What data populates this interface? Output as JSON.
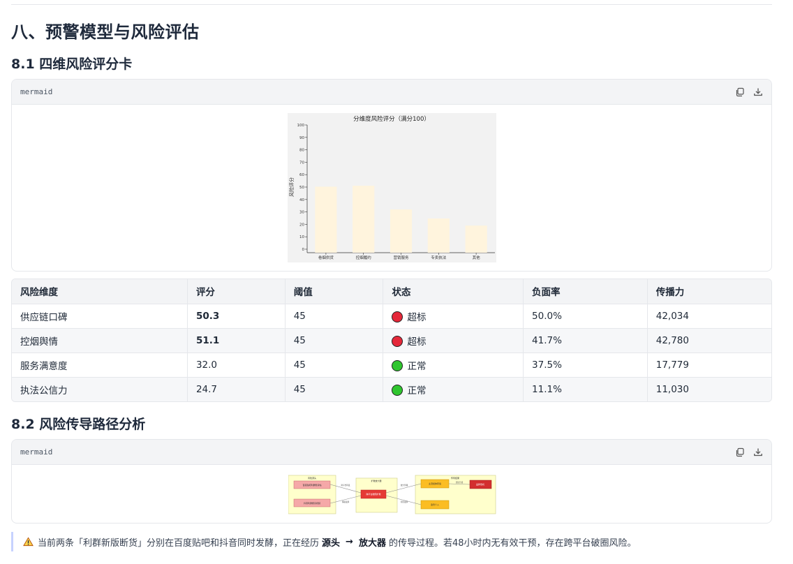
{
  "section_title": "八、预警模型与风险评估",
  "sub1_title": "8.1 四维风险评分卡",
  "sub2_title": "8.2 风险传导路径分析",
  "code_lang": "mermaid",
  "chart_data": {
    "type": "bar",
    "title": "分维度风险评分（满分100）",
    "ylabel": "风险评分",
    "xlabel": "",
    "categories": [
      "卷烟供货",
      "控烟履约",
      "营销服务",
      "专卖执法",
      "其他"
    ],
    "values": [
      50.3,
      51.1,
      32.0,
      24.7,
      19
    ],
    "yticks": [
      0,
      10,
      20,
      30,
      40,
      50,
      60,
      70,
      80,
      90,
      100
    ],
    "ylim": [
      0,
      100
    ],
    "bar_color": "#fff4dd",
    "bg_color": "#f2f2f2"
  },
  "table": {
    "headers": [
      "风险维度",
      "评分",
      "阈值",
      "状态",
      "负面率",
      "传播力"
    ],
    "rows": [
      {
        "dim": "供应链口碑",
        "score": "50.3",
        "threshold": "45",
        "status": "超标",
        "status_color": "red",
        "neg": "50.0%",
        "spread": "42,034",
        "bold": true
      },
      {
        "dim": "控烟舆情",
        "score": "51.1",
        "threshold": "45",
        "status": "超标",
        "status_color": "red",
        "neg": "41.7%",
        "spread": "42,780",
        "bold": true
      },
      {
        "dim": "服务满意度",
        "score": "32.0",
        "threshold": "45",
        "status": "正常",
        "status_color": "green",
        "neg": "37.5%",
        "spread": "17,779",
        "bold": false
      },
      {
        "dim": "执法公信力",
        "score": "24.7",
        "threshold": "45",
        "status": "正常",
        "status_color": "green",
        "neg": "11.1%",
        "spread": "11,030",
        "bold": false
      }
    ]
  },
  "flow": {
    "groups": [
      "风险源头",
      "扩散放大器",
      "传导结果"
    ],
    "nodes": [
      "百度贴吧利群断货帖",
      "抖音利群断货视频",
      "跨平台破圈扩散",
      "主流媒体转载",
      "监管介入",
      "品牌危机"
    ],
    "edges": [
      "跨平台转发",
      "情绪发酵",
      "放大传播",
      "持续发酵",
      "舆论升级"
    ]
  },
  "callout": {
    "icon": "warning-icon",
    "text_before": "当前两条「利群新版断货」分别在百度贴吧和抖音同时发酵，正在经历",
    "bold1": "源头",
    "arrow": "→",
    "bold2": "放大器",
    "text_after": "的传导过程。若48小时内无有效干预，存在跨平台破圈风险。"
  }
}
